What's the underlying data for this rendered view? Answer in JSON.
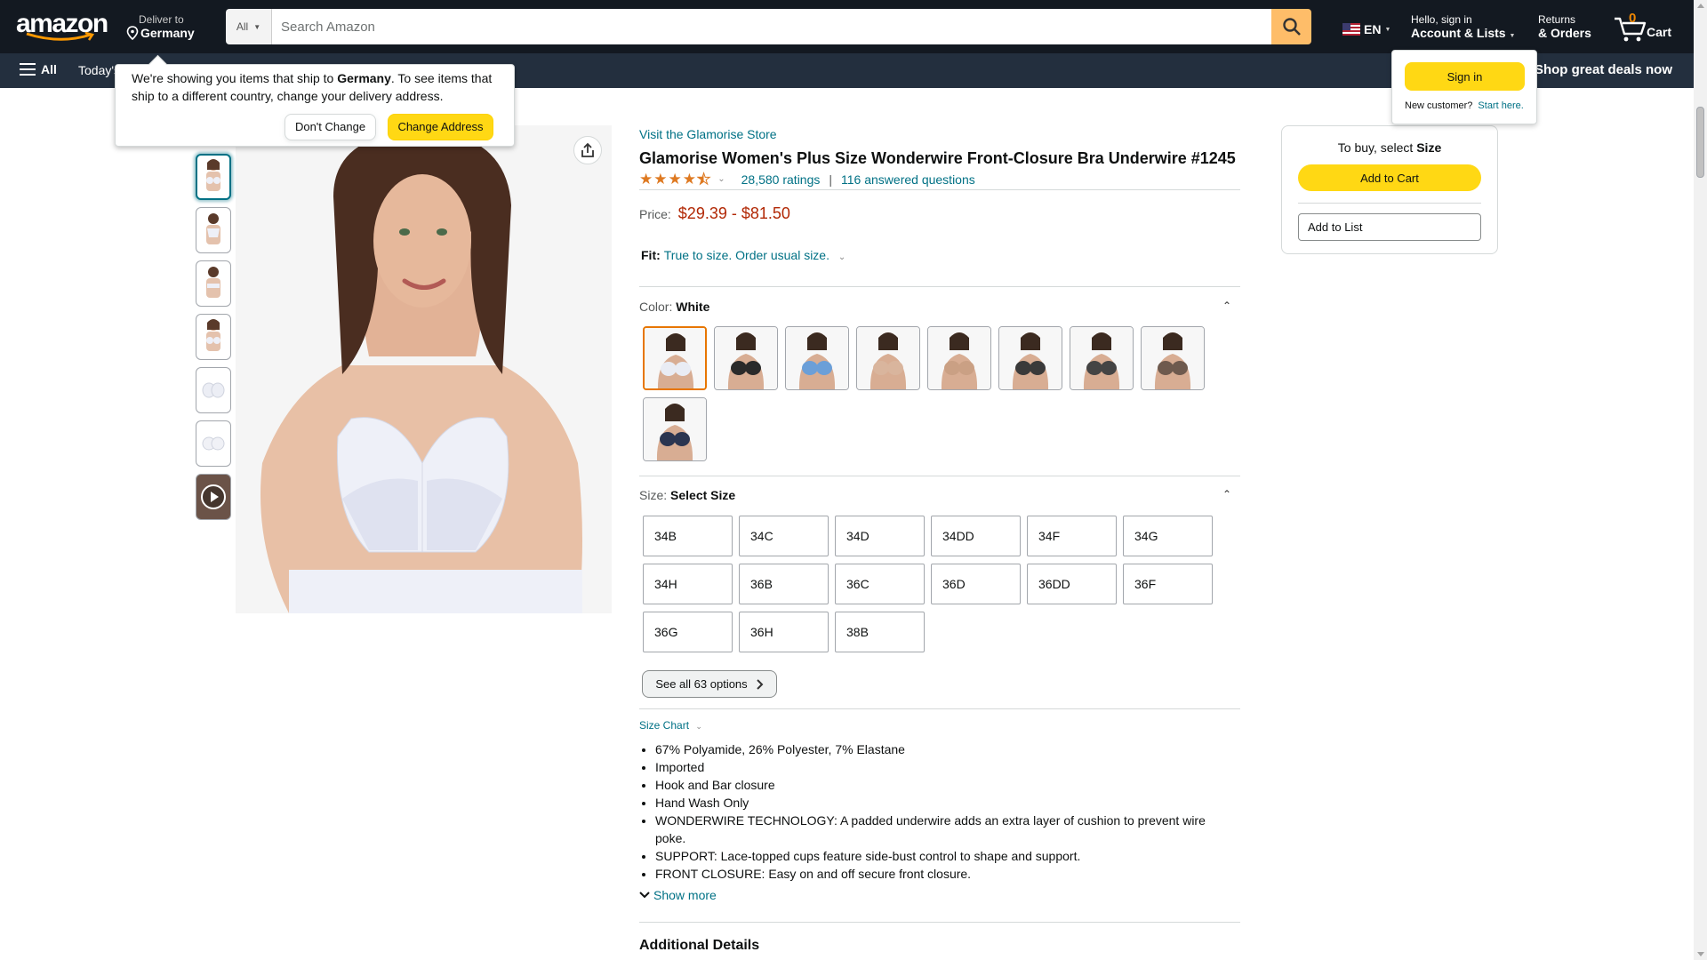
{
  "header": {
    "logo_text": "amazon",
    "deliver_line1": "Deliver to",
    "deliver_line2": "Germany",
    "search_category": "All",
    "search_placeholder": "Search Amazon",
    "language": "EN",
    "account_line1": "Hello, sign in",
    "account_line2": "Account & Lists",
    "returns_line1": "Returns",
    "returns_line2": "& Orders",
    "cart_count": "0",
    "cart_label": "Cart"
  },
  "navbar": {
    "all_label": "All",
    "today_label": "Today's Deals",
    "deals_label": "Shop great deals now"
  },
  "delivery_popover": {
    "text_before": "We're showing you items that ship to ",
    "country": "Germany",
    "text_after": ". To see items that ship to a different country, change your delivery address.",
    "dont_change": "Don't Change",
    "change_address": "Change Address"
  },
  "signin_popover": {
    "button": "Sign in",
    "new_customer": "New customer?",
    "start_here": "Start here."
  },
  "product": {
    "store_link": "Visit the Glamorise Store",
    "title": "Glamorise Women's Plus Size Wonderwire Front-Closure Bra Underwire #1245",
    "rating": 4.5,
    "ratings_count": "28,580 ratings",
    "answered": "116 answered questions",
    "price_label": "Price:",
    "price_low": "$29.39",
    "price_sep": "-",
    "price_high": "$81.50",
    "fit_label": "Fit:",
    "fit_value": "True to size. Order usual size.",
    "color_label": "Color:",
    "color_value": "White",
    "size_label": "Size:",
    "size_value": "Select Size",
    "sizes": [
      "34B",
      "34C",
      "34D",
      "34DD",
      "34F",
      "34G",
      "34H",
      "36B",
      "36C",
      "36D",
      "36DD",
      "36F",
      "36G",
      "36H",
      "38B"
    ],
    "see_all": "See all 63 options",
    "size_chart": "Size Chart",
    "bullets": [
      "67% Polyamide, 26% Polyester, 7% Elastane",
      "Imported",
      "Hook and Bar closure",
      "Hand Wash Only",
      "WONDERWIRE TECHNOLOGY: A padded underwire adds an extra layer of cushion to prevent wire poke.",
      "SUPPORT: Lace-topped cups feature side-bust control to shape and support.",
      "FRONT CLOSURE: Easy on and off secure front closure."
    ],
    "show_more": "Show more",
    "additional_details": "Additional Details"
  },
  "swatch_colors": [
    "#e9ecf4",
    "#2a2a2a",
    "#6b9fd8",
    "#d9b59d",
    "#caa084",
    "#3a3a3a",
    "#444444",
    "#6e5a4e",
    "#2b3550"
  ],
  "buybox": {
    "select_prefix": "To buy, select ",
    "select_bold": "Size",
    "add_to_cart": "Add to Cart",
    "add_to_list": "Add to List"
  },
  "colors": {
    "header_bg": "#131921",
    "nav_bg": "#232f3e",
    "accent": "#febd69",
    "button_yellow": "#ffd814",
    "link": "#007185",
    "price": "#b12704",
    "selected_border": "#e77600"
  }
}
